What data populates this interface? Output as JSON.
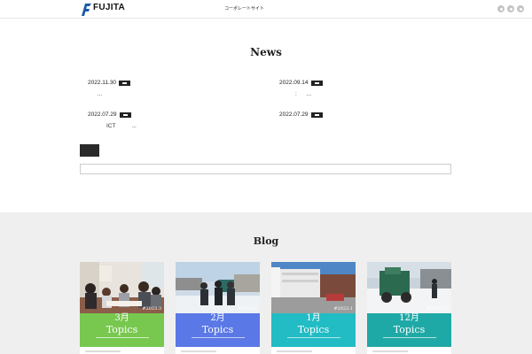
{
  "header": {
    "logo_name": "FUJITA",
    "nav_link": "コーポレートサイト"
  },
  "news": {
    "title": "News",
    "items": [
      {
        "date": "2022.11.30",
        "text": "      ..."
      },
      {
        "date": "2022.09.14",
        "text": "          :      ..."
      },
      {
        "date": "2022.07.29",
        "text": "ICT          ..."
      },
      {
        "date": "2022.07.29",
        "text": ""
      }
    ]
  },
  "blog": {
    "title": "Blog",
    "cards": [
      {
        "month": "3月",
        "topics": "Topics",
        "stamp": "#2023.3",
        "color": "#78c850"
      },
      {
        "month": "2月",
        "topics": "Topics",
        "stamp": "#2023.2",
        "color": "#5a78e6"
      },
      {
        "month": "1月",
        "topics": "Topics",
        "stamp": "#2023.1",
        "color": "#22bcc4"
      },
      {
        "month": "12月",
        "topics": "Topics",
        "stamp": "#2022.12",
        "color": "#1fa9a6"
      }
    ]
  },
  "colors": {
    "accent_dark": "#222222",
    "blog_bg": "#efefef",
    "logo_blue": "#1b5aa8"
  },
  "icons": {
    "social": [
      "twitter-icon",
      "instagram-icon",
      "facebook-icon"
    ]
  }
}
